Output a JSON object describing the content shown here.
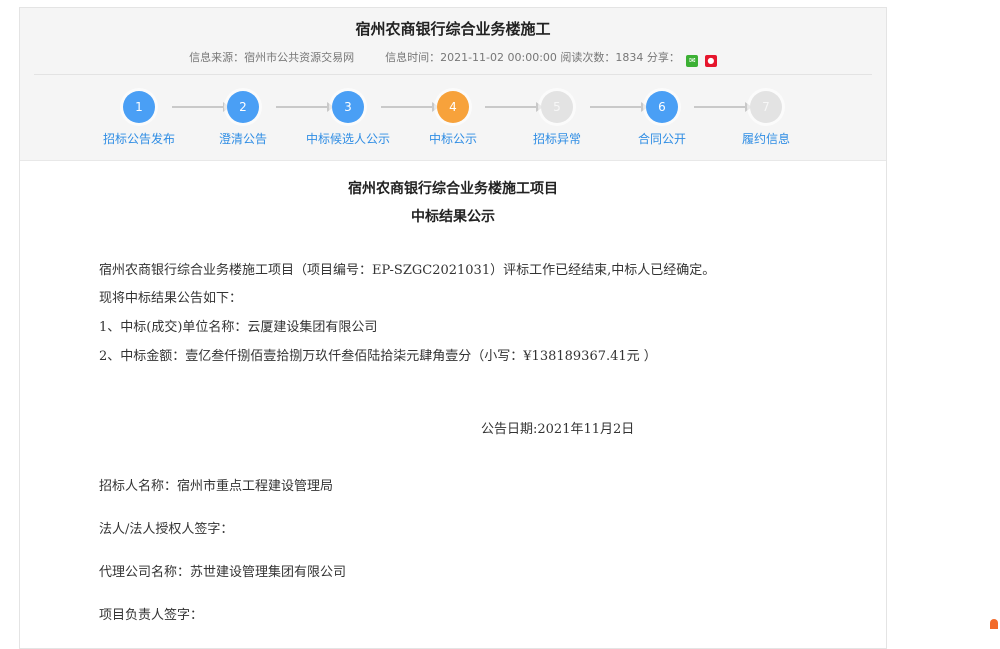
{
  "header": {
    "title": "宿州农商银行综合业务楼施工",
    "source_label": "信息来源：宿州市公共资源交易网",
    "time_label": "信息时间：2021-11-02 00:00:00 阅读次数：1834 分享：",
    "share_icons": [
      "wechat-icon",
      "weibo-icon"
    ]
  },
  "steps": [
    {
      "num": "1",
      "label": "招标公告发布",
      "status": "done"
    },
    {
      "num": "2",
      "label": "澄清公告",
      "status": "done"
    },
    {
      "num": "3",
      "label": "中标候选人公示",
      "status": "done"
    },
    {
      "num": "4",
      "label": "中标公示",
      "status": "current"
    },
    {
      "num": "5",
      "label": "招标异常",
      "status": "inactive"
    },
    {
      "num": "6",
      "label": "合同公开",
      "status": "done"
    },
    {
      "num": "7",
      "label": "履约信息",
      "status": "inactive"
    }
  ],
  "colors": {
    "done": "#4a9ff5",
    "current": "#f7a23b",
    "inactive": "#e3e3e3",
    "link": "#2f8de4"
  },
  "doc": {
    "title_line1": "宿州农商银行综合业务楼施工项目",
    "title_line2": "中标结果公示",
    "para1": "宿州农商银行综合业务楼施工项目（项目编号：EP-SZGC2021031）评标工作已经结束,中标人已经确定。",
    "para2": "现将中标结果公告如下：",
    "item1": "1、中标(成交)单位名称：云厦建设集团有限公司",
    "item2": "2、中标金额：壹亿叁仟捌佰壹拾捌万玖仟叁佰陆拾柒元肆角壹分（小写：¥138189367.41元 ）",
    "date": "公告日期:2021年11月2日",
    "tenderer": "招标人名称：宿州市重点工程建设管理局",
    "legal_rep": "法人/法人授权人签字：",
    "agent": "代理公司名称：苏世建设管理集团有限公司",
    "project_lead": "项目负责人签字："
  }
}
